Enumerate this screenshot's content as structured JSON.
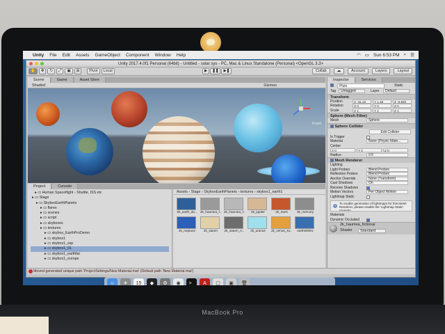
{
  "device": {
    "brand": "MacBook Pro"
  },
  "menubar": {
    "app": "Unity",
    "items": [
      "File",
      "Edit",
      "Assets",
      "GameObject",
      "Component",
      "Window",
      "Help"
    ],
    "clock": "Sun 6:53 PM"
  },
  "window": {
    "title": "Unity 2017.4.0f1 Personal (64bit) - Untitled - solar sys - PC, Mac & Linux Standalone (Personal) <OpenGL 3.3>"
  },
  "toolbar": {
    "pivot": "Pivot",
    "local": "Local",
    "collab": "Collab",
    "account": "Account",
    "layers": "Layers",
    "layout": "Layout"
  },
  "scene_tabs": [
    "Scene",
    "Game",
    "Asset Store"
  ],
  "scene_toolbar": {
    "shading": "Shaded",
    "gizmos": "Gizmos",
    "view": "Front"
  },
  "project": {
    "tabs": [
      "Project",
      "Console"
    ],
    "create": "Create",
    "tree": [
      "Human Spaceflight - Shuttle, ISS etc",
      "Stage",
      "SkyboxEarthPlanets",
      "flares",
      "scenes",
      "script",
      "skyboxes",
      "textures",
      "skybox_EarthProDemo",
      "skybox1",
      "skybox1_ssp",
      "skybox1_01",
      "skybox1_earthfar",
      "skybox1_europe"
    ],
    "selected_index": 11,
    "breadcrumb": "Assets › Stage › SkyboxEarthPlanets › textures › skybox1_earth1",
    "files": [
      {
        "name": "2k_earth_da...",
        "color": "#2f5f9a"
      },
      {
        "name": "2k_haumea_f...",
        "color": "#9a9a9a"
      },
      {
        "name": "2k_haumea_f...",
        "color": "#b8b8b8"
      },
      {
        "name": "2k_jupiter",
        "color": "#d7b895"
      },
      {
        "name": "2k_mars",
        "color": "#c4582c"
      },
      {
        "name": "2k_mercury",
        "color": "#8d8d8d"
      },
      {
        "name": "2k_neptune",
        "color": "#2b5fb8"
      },
      {
        "name": "2k_saturn",
        "color": "#e2d1a8"
      },
      {
        "name": "2k_saturn_ri...",
        "color": "#6d6d6d"
      },
      {
        "name": "2k_uranus",
        "color": "#9fe0ec"
      },
      {
        "name": "2k_venus_su...",
        "color": "#e2a03e"
      },
      {
        "name": "earth00001",
        "color": "#3a6fb0"
      }
    ]
  },
  "status": "Moved generated unique path 'ProjectSettings/New Material.mat' (Default path 'New Material.mat')",
  "inspector": {
    "tabs": [
      "Inspector",
      "Services"
    ],
    "object_name": "Pluto",
    "static_label": "Static",
    "tag": "Untagged",
    "layer": "Default",
    "transform": {
      "title": "Transform",
      "position": [
        "X -31.22",
        "Y 1.49",
        "Z -0.820"
      ],
      "rotation": [
        "X 0",
        "Y 0",
        "Z 0"
      ],
      "scale": [
        "X 1",
        "Y 1",
        "Z 1"
      ]
    },
    "mesh_filter": {
      "title": "Sphere (Mesh Filter)",
      "mesh_label": "Mesh",
      "mesh": "Sphere"
    },
    "collider": {
      "title": "Sphere Collider",
      "edit": "Edit Collider",
      "is_trigger": "Is Trigger",
      "material_label": "Material",
      "material": "None (Physic Mate...",
      "center_label": "Center",
      "center": [
        "X 0",
        "Y 0",
        "Z 0"
      ],
      "radius_label": "Radius",
      "radius": "0.5"
    },
    "renderer": {
      "title": "Mesh Renderer",
      "lighting": "Lighting",
      "light_probes": "Light Probes",
      "light_probes_val": "Blend Probes",
      "reflection_probes": "Reflection Probes",
      "reflection_probes_val": "Blend Probes",
      "anchor": "Anchor Override",
      "anchor_val": "None (Transform)",
      "cast_shadows": "Cast Shadows",
      "cast_shadows_val": "On",
      "receive_shadows": "Receive Shadows",
      "motion_vectors": "Motion Vectors",
      "motion_vectors_val": "Per Object Motion",
      "lightmap_static": "Lightmap Static",
      "info": "To enable generation of lightmaps for this Mesh Renderer, please enable the 'Lightmap Static' property.",
      "materials": "Materials",
      "dynamic_occluded": "Dynamic Occluded"
    },
    "material": {
      "name": "2k_haumea_fictional",
      "shader_label": "Shader",
      "shader": "Standard"
    }
  },
  "dock": [
    "Finder",
    "Launchpad",
    "Calendar",
    "Unity",
    "System Preferences",
    "Chrome",
    "Terminal",
    "Acrobat",
    "Preview",
    "Screenshot",
    "Trash"
  ]
}
